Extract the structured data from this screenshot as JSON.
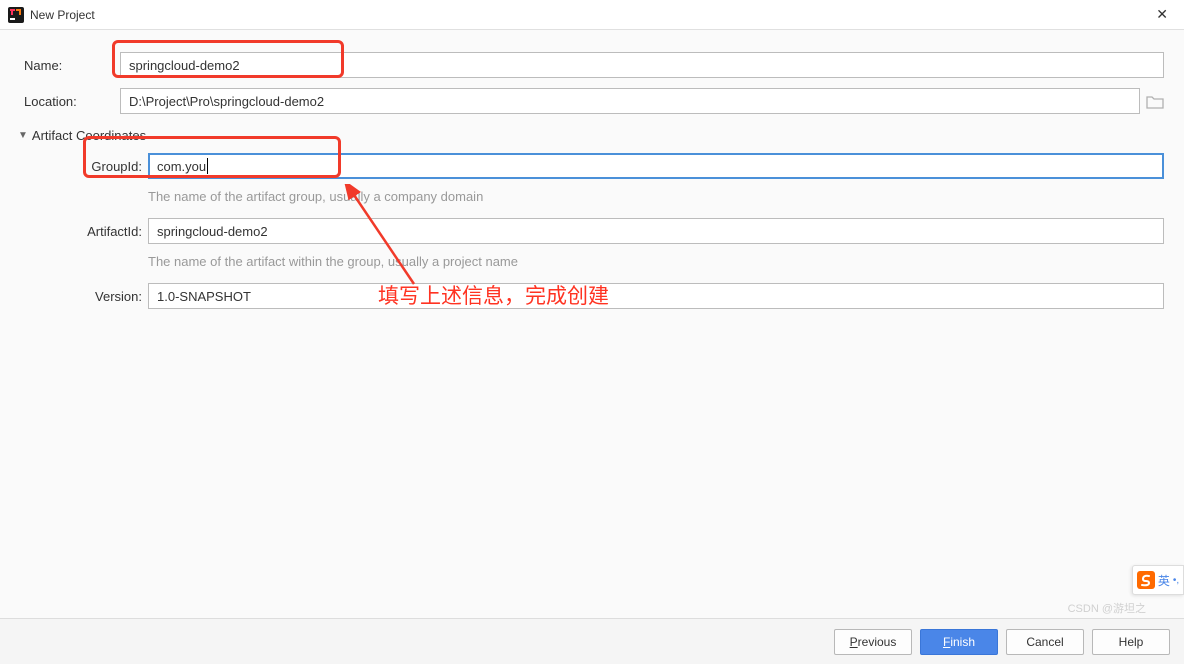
{
  "window": {
    "title": "New Project"
  },
  "form": {
    "name_label": "Name:",
    "name_value": "springcloud-demo2",
    "location_label": "Location:",
    "location_value": "D:\\Project\\Pro\\springcloud-demo2"
  },
  "section": {
    "title": "Artifact Coordinates",
    "groupid_label": "GroupId:",
    "groupid_value": "com.you",
    "groupid_hint": "The name of the artifact group, usually a company domain",
    "artifactid_label": "ArtifactId:",
    "artifactid_value": "springcloud-demo2",
    "artifactid_hint": "The name of the artifact within the group, usually a project name",
    "version_label": "Version:",
    "version_value": "1.0-SNAPSHOT"
  },
  "annotation": {
    "text": "填写上述信息，完成创建"
  },
  "buttons": {
    "previous_u": "P",
    "previous": "revious",
    "finish_u": "F",
    "finish": "inish",
    "cancel": "Cancel",
    "help": "Help"
  },
  "ime": {
    "label": "英"
  },
  "watermark": "CSDN @游坦之"
}
